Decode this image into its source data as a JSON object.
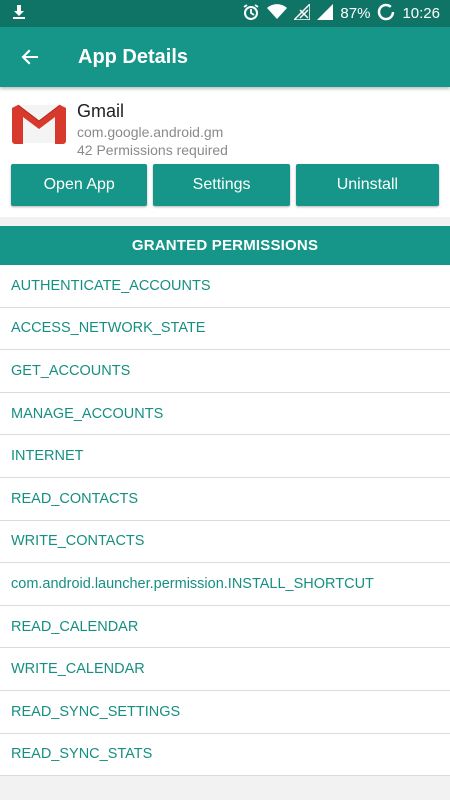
{
  "status_bar": {
    "battery": "87%",
    "time": "10:26"
  },
  "app_bar": {
    "title": "App Details"
  },
  "app": {
    "name": "Gmail",
    "package": "com.google.android.gm",
    "permissions_required": "42 Permissions required"
  },
  "actions": {
    "open": "Open App",
    "settings": "Settings",
    "uninstall": "Uninstall"
  },
  "permissions": {
    "header": "GRANTED PERMISSIONS",
    "items": [
      "AUTHENTICATE_ACCOUNTS",
      "ACCESS_NETWORK_STATE",
      "GET_ACCOUNTS",
      "MANAGE_ACCOUNTS",
      "INTERNET",
      "READ_CONTACTS",
      "WRITE_CONTACTS",
      "com.android.launcher.permission.INSTALL_SHORTCUT",
      "READ_CALENDAR",
      "WRITE_CALENDAR",
      "READ_SYNC_SETTINGS",
      "READ_SYNC_STATS"
    ]
  },
  "colors": {
    "primary": "#159688",
    "primary_dark": "#0f7466",
    "permission_text": "#168f82"
  }
}
